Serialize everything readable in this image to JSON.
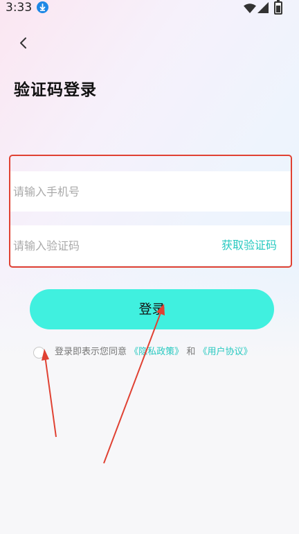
{
  "status_bar": {
    "time": "3:33"
  },
  "header": {
    "title": "验证码登录"
  },
  "form": {
    "phone_placeholder": "请输入手机号",
    "code_placeholder": "请输入验证码",
    "get_code_label": "获取验证码"
  },
  "login_button_label": "登录",
  "agreement": {
    "prefix": "登录即表示您同意",
    "privacy_link": "《隐私政策》",
    "joiner": "和",
    "user_link": "《用户协议》"
  },
  "colors": {
    "accent": "#40f0df",
    "link": "#27c9c0",
    "highlight_border": "#e04132"
  }
}
